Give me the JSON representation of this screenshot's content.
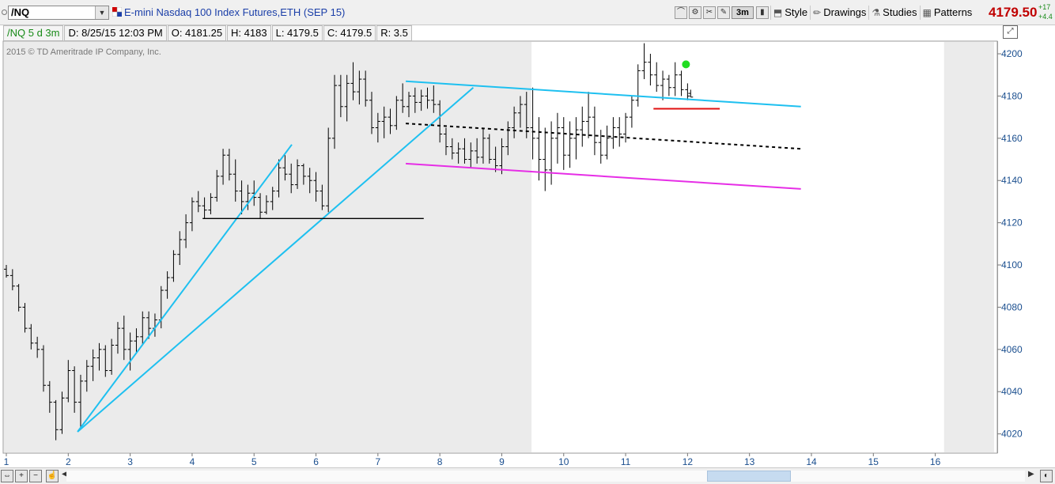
{
  "header": {
    "symbol": "/NQ",
    "description": "E-mini Nasdaq 100 Index Futures,ETH (SEP 15)",
    "aggregation": "3m",
    "style_label": "Style",
    "drawings_label": "Drawings",
    "studies_label": "Studies",
    "patterns_label": "Patterns",
    "last_price": "4179.50",
    "change": "+17",
    "change_pct": "+4.4"
  },
  "info": {
    "chart_label": "/NQ 5 d 3m",
    "datetime": "D: 8/25/15 12:03 PM",
    "open": "O: 4181.25",
    "high": "H: 4183",
    "low": "L: 4179.5",
    "close": "C: 4179.5",
    "range": "R: 3.5"
  },
  "copyright": "2015 © TD Ameritrade IP Company, Inc.",
  "colors": {
    "trend_cyan": "#1ec0f0",
    "channel_magenta": "#e62ee6",
    "support_red": "#e01010",
    "marker_green": "#22dd22",
    "shade": "#ebebeb",
    "axis_text": "#1b4f8f"
  },
  "chart_data": {
    "type": "ohlc",
    "x_ticks": [
      1,
      2,
      3,
      4,
      5,
      6,
      7,
      8,
      9,
      10,
      11,
      12,
      13,
      14,
      15,
      16
    ],
    "y_ticks": [
      4020,
      4040,
      4060,
      4080,
      4100,
      4120,
      4140,
      4160,
      4180,
      4200
    ],
    "xlim": [
      1,
      16.95
    ],
    "ylim": [
      4012,
      4206
    ],
    "grid": false,
    "shaded_ranges": [
      [
        1,
        9.48
      ],
      [
        16.18,
        16.95
      ]
    ],
    "bars": [
      {
        "x": 1.0,
        "o": 4098,
        "h": 4100,
        "l": 4094,
        "c": 4095
      },
      {
        "x": 1.1,
        "o": 4095,
        "h": 4098,
        "l": 4088,
        "c": 4090
      },
      {
        "x": 1.2,
        "o": 4090,
        "h": 4091,
        "l": 4078,
        "c": 4080
      },
      {
        "x": 1.3,
        "o": 4080,
        "h": 4082,
        "l": 4068,
        "c": 4070
      },
      {
        "x": 1.4,
        "o": 4070,
        "h": 4072,
        "l": 4060,
        "c": 4063
      },
      {
        "x": 1.5,
        "o": 4063,
        "h": 4066,
        "l": 4056,
        "c": 4060
      },
      {
        "x": 1.6,
        "o": 4060,
        "h": 4062,
        "l": 4040,
        "c": 4043
      },
      {
        "x": 1.7,
        "o": 4043,
        "h": 4045,
        "l": 4030,
        "c": 4035
      },
      {
        "x": 1.8,
        "o": 4035,
        "h": 4036,
        "l": 4017,
        "c": 4022
      },
      {
        "x": 1.9,
        "o": 4022,
        "h": 4040,
        "l": 4020,
        "c": 4037
      },
      {
        "x": 2.0,
        "o": 4037,
        "h": 4055,
        "l": 4035,
        "c": 4050
      },
      {
        "x": 2.1,
        "o": 4050,
        "h": 4052,
        "l": 4030,
        "c": 4035
      },
      {
        "x": 2.2,
        "o": 4035,
        "h": 4048,
        "l": 4022,
        "c": 4045
      },
      {
        "x": 2.3,
        "o": 4045,
        "h": 4055,
        "l": 4040,
        "c": 4052
      },
      {
        "x": 2.4,
        "o": 4052,
        "h": 4060,
        "l": 4045,
        "c": 4056
      },
      {
        "x": 2.5,
        "o": 4056,
        "h": 4063,
        "l": 4050,
        "c": 4060
      },
      {
        "x": 2.6,
        "o": 4060,
        "h": 4062,
        "l": 4047,
        "c": 4050
      },
      {
        "x": 2.7,
        "o": 4050,
        "h": 4065,
        "l": 4048,
        "c": 4062
      },
      {
        "x": 2.8,
        "o": 4062,
        "h": 4073,
        "l": 4058,
        "c": 4070
      },
      {
        "x": 2.9,
        "o": 4070,
        "h": 4076,
        "l": 4055,
        "c": 4060
      },
      {
        "x": 3.0,
        "o": 4060,
        "h": 4068,
        "l": 4050,
        "c": 4064
      },
      {
        "x": 3.1,
        "o": 4064,
        "h": 4070,
        "l": 4058,
        "c": 4066
      },
      {
        "x": 3.2,
        "o": 4066,
        "h": 4078,
        "l": 4062,
        "c": 4075
      },
      {
        "x": 3.3,
        "o": 4075,
        "h": 4078,
        "l": 4065,
        "c": 4070
      },
      {
        "x": 3.4,
        "o": 4070,
        "h": 4077,
        "l": 4066,
        "c": 4074
      },
      {
        "x": 3.5,
        "o": 4074,
        "h": 4090,
        "l": 4070,
        "c": 4088
      },
      {
        "x": 3.6,
        "o": 4088,
        "h": 4097,
        "l": 4084,
        "c": 4094
      },
      {
        "x": 3.7,
        "o": 4094,
        "h": 4107,
        "l": 4092,
        "c": 4105
      },
      {
        "x": 3.8,
        "o": 4105,
        "h": 4116,
        "l": 4100,
        "c": 4112
      },
      {
        "x": 3.9,
        "o": 4112,
        "h": 4124,
        "l": 4108,
        "c": 4120
      },
      {
        "x": 4.0,
        "o": 4120,
        "h": 4132,
        "l": 4116,
        "c": 4130
      },
      {
        "x": 4.1,
        "o": 4130,
        "h": 4135,
        "l": 4125,
        "c": 4128
      },
      {
        "x": 4.2,
        "o": 4128,
        "h": 4132,
        "l": 4122,
        "c": 4126
      },
      {
        "x": 4.3,
        "o": 4126,
        "h": 4134,
        "l": 4124,
        "c": 4132
      },
      {
        "x": 4.4,
        "o": 4132,
        "h": 4145,
        "l": 4130,
        "c": 4142
      },
      {
        "x": 4.5,
        "o": 4142,
        "h": 4155,
        "l": 4138,
        "c": 4152
      },
      {
        "x": 4.6,
        "o": 4152,
        "h": 4155,
        "l": 4140,
        "c": 4143
      },
      {
        "x": 4.7,
        "o": 4143,
        "h": 4150,
        "l": 4130,
        "c": 4135
      },
      {
        "x": 4.8,
        "o": 4135,
        "h": 4140,
        "l": 4124,
        "c": 4130
      },
      {
        "x": 4.9,
        "o": 4130,
        "h": 4138,
        "l": 4126,
        "c": 4134
      },
      {
        "x": 5.0,
        "o": 4134,
        "h": 4140,
        "l": 4128,
        "c": 4132
      },
      {
        "x": 5.1,
        "o": 4132,
        "h": 4134,
        "l": 4122,
        "c": 4125
      },
      {
        "x": 5.2,
        "o": 4125,
        "h": 4133,
        "l": 4124,
        "c": 4130
      },
      {
        "x": 5.3,
        "o": 4130,
        "h": 4137,
        "l": 4126,
        "c": 4135
      },
      {
        "x": 5.4,
        "o": 4135,
        "h": 4150,
        "l": 4132,
        "c": 4146
      },
      {
        "x": 5.5,
        "o": 4146,
        "h": 4152,
        "l": 4140,
        "c": 4143
      },
      {
        "x": 5.6,
        "o": 4143,
        "h": 4148,
        "l": 4134,
        "c": 4138
      },
      {
        "x": 5.7,
        "o": 4138,
        "h": 4150,
        "l": 4136,
        "c": 4147
      },
      {
        "x": 5.8,
        "o": 4147,
        "h": 4148,
        "l": 4138,
        "c": 4142
      },
      {
        "x": 5.9,
        "o": 4142,
        "h": 4146,
        "l": 4134,
        "c": 4140
      },
      {
        "x": 6.0,
        "o": 4140,
        "h": 4144,
        "l": 4130,
        "c": 4135
      },
      {
        "x": 6.1,
        "o": 4135,
        "h": 4138,
        "l": 4126,
        "c": 4128
      },
      {
        "x": 6.2,
        "o": 4128,
        "h": 4165,
        "l": 4125,
        "c": 4160
      },
      {
        "x": 6.3,
        "o": 4160,
        "h": 4190,
        "l": 4155,
        "c": 4185
      },
      {
        "x": 6.4,
        "o": 4185,
        "h": 4190,
        "l": 4170,
        "c": 4175
      },
      {
        "x": 6.5,
        "o": 4175,
        "h": 4190,
        "l": 4168,
        "c": 4186
      },
      {
        "x": 6.6,
        "o": 4186,
        "h": 4196,
        "l": 4178,
        "c": 4182
      },
      {
        "x": 6.7,
        "o": 4182,
        "h": 4192,
        "l": 4176,
        "c": 4188
      },
      {
        "x": 6.8,
        "o": 4188,
        "h": 4192,
        "l": 4175,
        "c": 4178
      },
      {
        "x": 6.9,
        "o": 4178,
        "h": 4182,
        "l": 4162,
        "c": 4165
      },
      {
        "x": 7.0,
        "o": 4165,
        "h": 4172,
        "l": 4158,
        "c": 4168
      },
      {
        "x": 7.1,
        "o": 4168,
        "h": 4175,
        "l": 4160,
        "c": 4170
      },
      {
        "x": 7.2,
        "o": 4170,
        "h": 4174,
        "l": 4162,
        "c": 4166
      },
      {
        "x": 7.3,
        "o": 4166,
        "h": 4180,
        "l": 4164,
        "c": 4178
      },
      {
        "x": 7.4,
        "o": 4178,
        "h": 4186,
        "l": 4172,
        "c": 4175
      },
      {
        "x": 7.5,
        "o": 4175,
        "h": 4182,
        "l": 4170,
        "c": 4180
      },
      {
        "x": 7.6,
        "o": 4180,
        "h": 4184,
        "l": 4172,
        "c": 4177
      },
      {
        "x": 7.7,
        "o": 4177,
        "h": 4183,
        "l": 4173,
        "c": 4180
      },
      {
        "x": 7.8,
        "o": 4180,
        "h": 4184,
        "l": 4174,
        "c": 4178
      },
      {
        "x": 7.9,
        "o": 4178,
        "h": 4185,
        "l": 4172,
        "c": 4176
      },
      {
        "x": 8.0,
        "o": 4176,
        "h": 4178,
        "l": 4158,
        "c": 4162
      },
      {
        "x": 8.1,
        "o": 4162,
        "h": 4165,
        "l": 4152,
        "c": 4156
      },
      {
        "x": 8.2,
        "o": 4156,
        "h": 4160,
        "l": 4150,
        "c": 4153
      },
      {
        "x": 8.3,
        "o": 4153,
        "h": 4158,
        "l": 4148,
        "c": 4155
      },
      {
        "x": 8.4,
        "o": 4155,
        "h": 4160,
        "l": 4148,
        "c": 4150
      },
      {
        "x": 8.5,
        "o": 4150,
        "h": 4158,
        "l": 4146,
        "c": 4154
      },
      {
        "x": 8.6,
        "o": 4154,
        "h": 4160,
        "l": 4148,
        "c": 4151
      },
      {
        "x": 8.7,
        "o": 4151,
        "h": 4165,
        "l": 4148,
        "c": 4160
      },
      {
        "x": 8.8,
        "o": 4160,
        "h": 4162,
        "l": 4148,
        "c": 4150
      },
      {
        "x": 8.9,
        "o": 4150,
        "h": 4156,
        "l": 4144,
        "c": 4147
      },
      {
        "x": 9.0,
        "o": 4147,
        "h": 4160,
        "l": 4143,
        "c": 4156
      },
      {
        "x": 9.1,
        "o": 4156,
        "h": 4168,
        "l": 4152,
        "c": 4165
      },
      {
        "x": 9.2,
        "o": 4165,
        "h": 4175,
        "l": 4160,
        "c": 4172
      },
      {
        "x": 9.3,
        "o": 4172,
        "h": 4180,
        "l": 4165,
        "c": 4176
      },
      {
        "x": 9.4,
        "o": 4176,
        "h": 4182,
        "l": 4160,
        "c": 4165
      },
      {
        "x": 9.5,
        "o": 4165,
        "h": 4184,
        "l": 4150,
        "c": 4160
      },
      {
        "x": 9.6,
        "o": 4160,
        "h": 4170,
        "l": 4140,
        "c": 4150
      },
      {
        "x": 9.7,
        "o": 4150,
        "h": 4165,
        "l": 4135,
        "c": 4145
      },
      {
        "x": 9.8,
        "o": 4145,
        "h": 4168,
        "l": 4138,
        "c": 4160
      },
      {
        "x": 9.9,
        "o": 4160,
        "h": 4172,
        "l": 4148,
        "c": 4165
      },
      {
        "x": 10.0,
        "o": 4165,
        "h": 4170,
        "l": 4145,
        "c": 4152
      },
      {
        "x": 10.1,
        "o": 4152,
        "h": 4168,
        "l": 4146,
        "c": 4160
      },
      {
        "x": 10.2,
        "o": 4160,
        "h": 4170,
        "l": 4150,
        "c": 4164
      },
      {
        "x": 10.3,
        "o": 4164,
        "h": 4175,
        "l": 4156,
        "c": 4168
      },
      {
        "x": 10.4,
        "o": 4168,
        "h": 4182,
        "l": 4160,
        "c": 4170
      },
      {
        "x": 10.5,
        "o": 4170,
        "h": 4175,
        "l": 4152,
        "c": 4158
      },
      {
        "x": 10.6,
        "o": 4158,
        "h": 4164,
        "l": 4148,
        "c": 4152
      },
      {
        "x": 10.7,
        "o": 4152,
        "h": 4166,
        "l": 4150,
        "c": 4160
      },
      {
        "x": 10.8,
        "o": 4160,
        "h": 4170,
        "l": 4155,
        "c": 4165
      },
      {
        "x": 10.9,
        "o": 4165,
        "h": 4170,
        "l": 4156,
        "c": 4162
      },
      {
        "x": 11.0,
        "o": 4162,
        "h": 4172,
        "l": 4158,
        "c": 4170
      },
      {
        "x": 11.1,
        "o": 4170,
        "h": 4180,
        "l": 4165,
        "c": 4178
      },
      {
        "x": 11.2,
        "o": 4178,
        "h": 4195,
        "l": 4175,
        "c": 4192
      },
      {
        "x": 11.3,
        "o": 4192,
        "h": 4205,
        "l": 4188,
        "c": 4196
      },
      {
        "x": 11.4,
        "o": 4196,
        "h": 4200,
        "l": 4185,
        "c": 4190
      },
      {
        "x": 11.5,
        "o": 4190,
        "h": 4196,
        "l": 4182,
        "c": 4185
      },
      {
        "x": 11.6,
        "o": 4185,
        "h": 4192,
        "l": 4178,
        "c": 4188
      },
      {
        "x": 11.7,
        "o": 4188,
        "h": 4190,
        "l": 4180,
        "c": 4184
      },
      {
        "x": 11.8,
        "o": 4184,
        "h": 4196,
        "l": 4180,
        "c": 4190
      },
      {
        "x": 11.9,
        "o": 4190,
        "h": 4192,
        "l": 4180,
        "c": 4183
      },
      {
        "x": 12.0,
        "o": 4183,
        "h": 4186,
        "l": 4178,
        "c": 4180
      },
      {
        "x": 12.05,
        "o": 4181.25,
        "h": 4183,
        "l": 4179.5,
        "c": 4179.5
      }
    ],
    "trendlines": [
      {
        "name": "trend-cyan-1",
        "color": "#1ec0f0",
        "style": "solid",
        "x1": 2.15,
        "y1": 4021,
        "x2": 5.61,
        "y2": 4157
      },
      {
        "name": "trend-cyan-2",
        "color": "#1ec0f0",
        "style": "solid",
        "x1": 2.15,
        "y1": 4021,
        "x2": 8.54,
        "y2": 4184
      },
      {
        "name": "channel-upper",
        "color": "#1ec0f0",
        "style": "solid",
        "x1": 7.45,
        "y1": 4187,
        "x2": 13.83,
        "y2": 4175
      },
      {
        "name": "channel-mid",
        "color": "#000000",
        "style": "dashed",
        "x1": 7.45,
        "y1": 4167,
        "x2": 13.83,
        "y2": 4155
      },
      {
        "name": "channel-lower",
        "color": "#e62ee6",
        "style": "solid",
        "x1": 7.45,
        "y1": 4148,
        "x2": 13.83,
        "y2": 4136
      },
      {
        "name": "support-line",
        "color": "#000000",
        "style": "solid",
        "x1": 4.17,
        "y1": 4122,
        "x2": 7.74,
        "y2": 4122
      },
      {
        "name": "red-level",
        "color": "#e01010",
        "style": "solid",
        "x1": 11.45,
        "y1": 4174,
        "x2": 12.52,
        "y2": 4174
      }
    ],
    "markers": [
      {
        "x": 12.0,
        "y": 4195,
        "color": "#22dd22"
      }
    ]
  }
}
